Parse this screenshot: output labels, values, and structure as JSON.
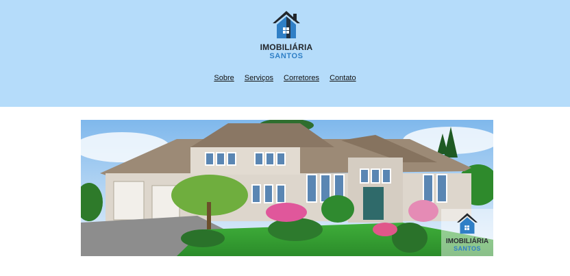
{
  "brand": {
    "line1": "IMOBILIÁRIA",
    "line2": "SANTOS"
  },
  "nav": {
    "items": [
      "Sobre",
      "Serviços",
      "Corretores",
      "Contato"
    ]
  },
  "hero": {
    "watermark_line1": "IMOBILIÁRIA",
    "watermark_line2": "SANTOS",
    "icon": "house-photo"
  },
  "colors": {
    "header_bg": "#b5dcfa",
    "brand_dark": "#22262b",
    "brand_blue": "#2f7fc6"
  }
}
